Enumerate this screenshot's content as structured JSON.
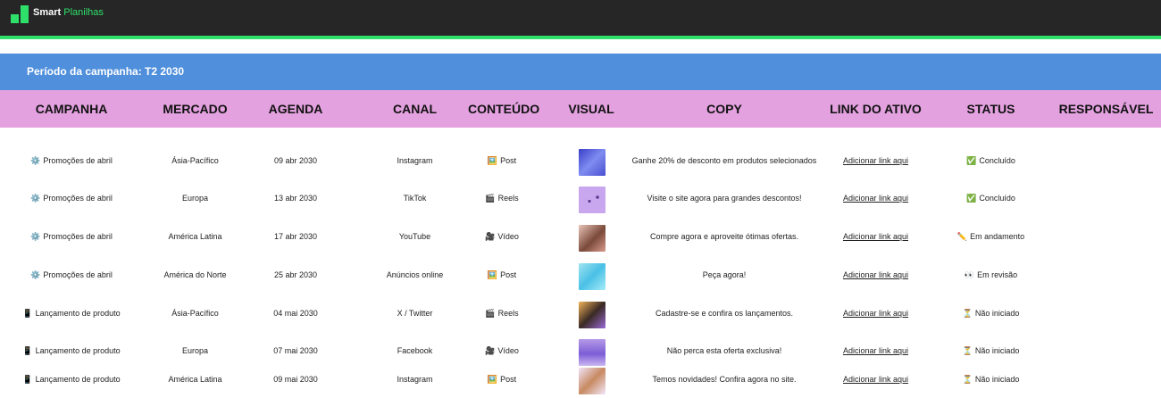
{
  "app": {
    "brand_bold": "Smart",
    "brand_rest": "Planilhas"
  },
  "period": {
    "label": "Período da campanha: T2 2030"
  },
  "colors": {
    "topbar": "#262626",
    "accent_green": "#2ee06a",
    "period_bar": "#4f8fdb",
    "header_bg": "#e3a1df"
  },
  "columns": [
    "CAMPANHA",
    "MERCADO",
    "AGENDA",
    "CANAL",
    "CONTEÚDO",
    "VISUAL",
    "COPY",
    "LINK DO ATIVO",
    "STATUS",
    "RESPONSÁVEL"
  ],
  "rows": [
    {
      "campaign_icon": "⚙️",
      "campaign": "Promoções de abril",
      "market": "Ásia-Pacífico",
      "date": "09 abr 2030",
      "channel": "Instagram",
      "content_icon": "🖼️",
      "content": "Post",
      "visual": "image-thumbnail",
      "copy": "Ganhe 20% de desconto em produtos selecionados",
      "link": "Adicionar link aqui",
      "status_icon": "✅",
      "status": "Concluído",
      "owner": ""
    },
    {
      "campaign_icon": "⚙️",
      "campaign": "Promoções de abril",
      "market": "Europa",
      "date": "13 abr 2030",
      "channel": "TikTok",
      "content_icon": "🎬",
      "content": "Reels",
      "visual": "image-thumbnail",
      "copy": "Visite o site agora para grandes descontos!",
      "link": "Adicionar link aqui",
      "status_icon": "✅",
      "status": "Concluído",
      "owner": ""
    },
    {
      "campaign_icon": "⚙️",
      "campaign": "Promoções de abril",
      "market": "América Latina",
      "date": "17 abr 2030",
      "channel": "YouTube",
      "content_icon": "🎥",
      "content": "Vídeo",
      "visual": "image-thumbnail",
      "copy": "Compre agora e aproveite ótimas ofertas.",
      "link": "Adicionar link aqui",
      "status_icon": "✏️",
      "status": "Em andamento",
      "owner": ""
    },
    {
      "campaign_icon": "⚙️",
      "campaign": "Promoções de abril",
      "market": "América do Norte",
      "date": "25 abr 2030",
      "channel": "Anúncios online",
      "content_icon": "🖼️",
      "content": "Post",
      "visual": "image-thumbnail",
      "copy": "Peça agora!",
      "link": "Adicionar link aqui",
      "status_icon": "👀",
      "status": "Em revisão",
      "owner": ""
    },
    {
      "campaign_icon": "📱",
      "campaign": "Lançamento de produto",
      "market": "Ásia-Pacífico",
      "date": "04 mai 2030",
      "channel": "X / Twitter",
      "content_icon": "🎬",
      "content": "Reels",
      "visual": "image-thumbnail",
      "copy": "Cadastre-se e confira os lançamentos.",
      "link": "Adicionar link aqui",
      "status_icon": "⏳",
      "status": "Não iniciado",
      "owner": ""
    },
    {
      "campaign_icon": "📱",
      "campaign": "Lançamento de produto",
      "market": "Europa",
      "date": "07 mai 2030",
      "channel": "Facebook",
      "content_icon": "🎥",
      "content": "Vídeo",
      "visual": "image-thumbnail",
      "copy": "Não perca esta oferta exclusiva!",
      "link": "Adicionar link aqui",
      "status_icon": "⏳",
      "status": "Não iniciado",
      "owner": ""
    },
    {
      "campaign_icon": "📱",
      "campaign": "Lançamento de produto",
      "market": "América Latina",
      "date": "09 mai 2030",
      "channel": "Instagram",
      "content_icon": "🖼️",
      "content": "Post",
      "visual": "image-thumbnail",
      "copy": "Temos novidades! Confira agora no site.",
      "link": "Adicionar link aqui",
      "status_icon": "⏳",
      "status": "Não iniciado",
      "owner": ""
    }
  ]
}
